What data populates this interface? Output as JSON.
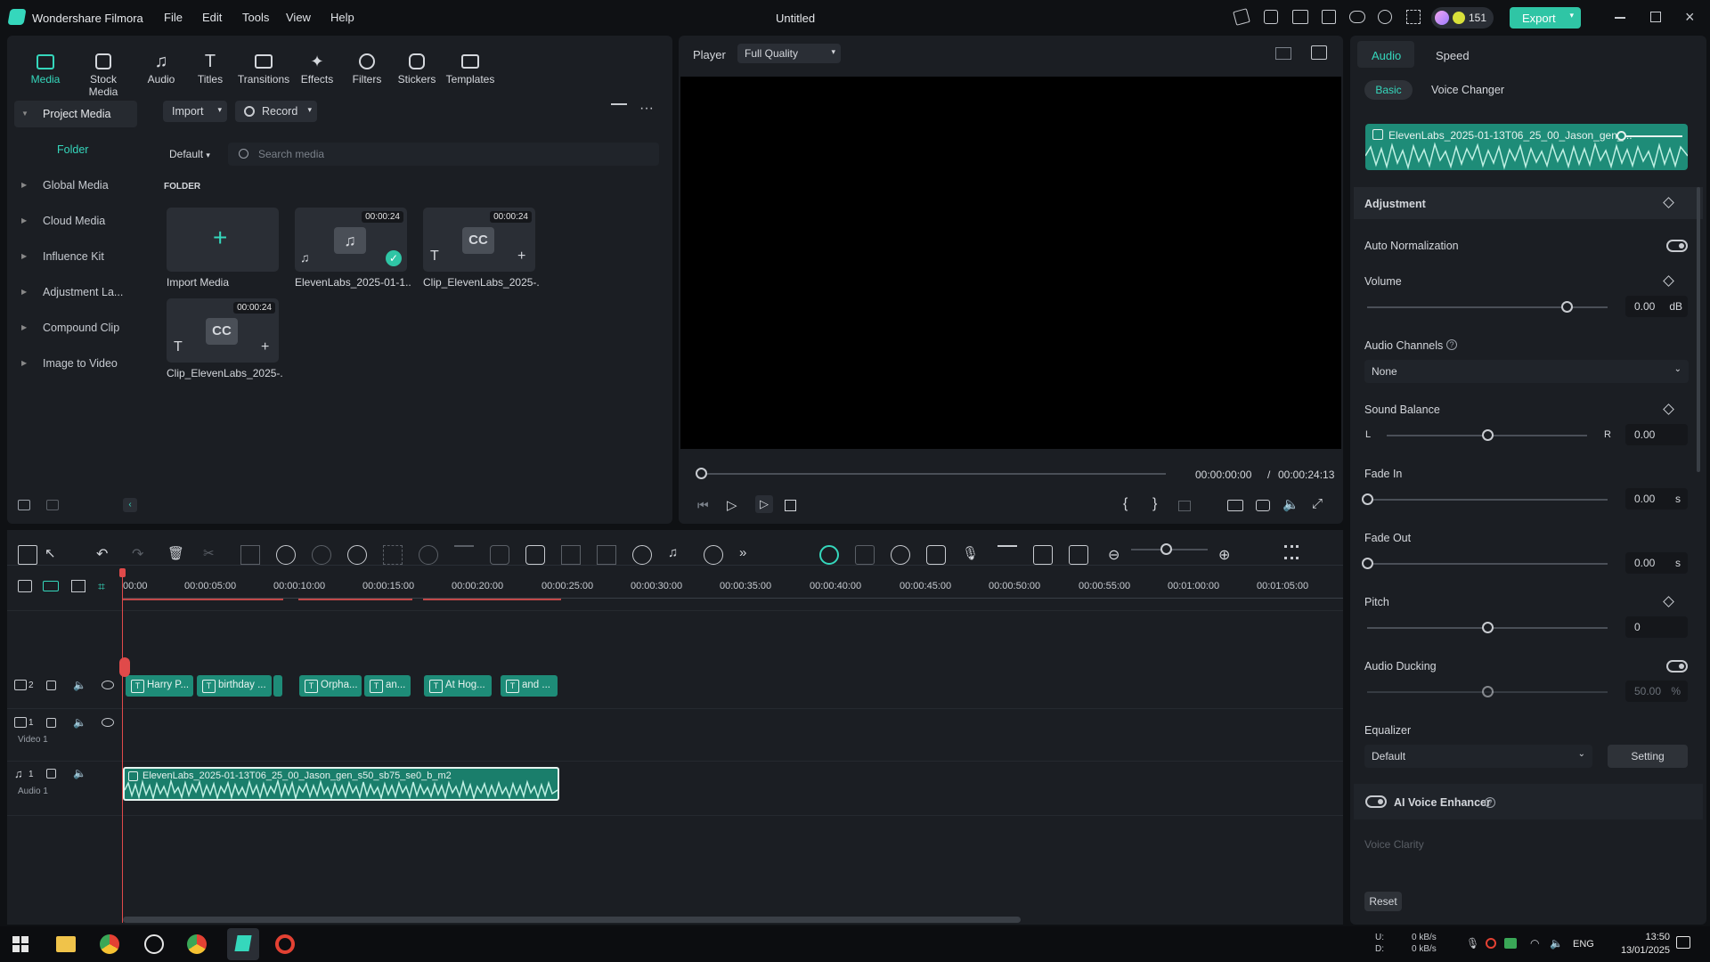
{
  "app": {
    "name": "Wondershare Filmora",
    "title": "Untitled",
    "credits": "151",
    "export_label": "Export"
  },
  "menu": [
    "File",
    "Edit",
    "Tools",
    "View",
    "Help"
  ],
  "tools": [
    {
      "label": "Media",
      "icon": "media-icon"
    },
    {
      "label": "Stock Media",
      "icon": "stock-media-icon"
    },
    {
      "label": "Audio",
      "icon": "audio-icon"
    },
    {
      "label": "Titles",
      "icon": "titles-icon"
    },
    {
      "label": "Transitions",
      "icon": "transitions-icon"
    },
    {
      "label": "Effects",
      "icon": "effects-icon"
    },
    {
      "label": "Filters",
      "icon": "filters-icon"
    },
    {
      "label": "Stickers",
      "icon": "stickers-icon"
    },
    {
      "label": "Templates",
      "icon": "templates-icon"
    }
  ],
  "sidebar": {
    "items": [
      "Project Media",
      "Folder",
      "Global Media",
      "Cloud Media",
      "Influence Kit",
      "Adjustment La...",
      "Compound Clip",
      "Image to Video"
    ]
  },
  "media": {
    "import_label": "Import",
    "record_label": "Record",
    "sort_label": "Default",
    "search_placeholder": "Search media",
    "folder_heading": "FOLDER",
    "items": [
      {
        "caption": "Import Media",
        "duration": ""
      },
      {
        "caption": "ElevenLabs_2025-01-1...",
        "duration": "00:00:24"
      },
      {
        "caption": "Clip_ElevenLabs_2025-...",
        "duration": "00:00:24"
      },
      {
        "caption": "Clip_ElevenLabs_2025-...",
        "duration": "00:00:24"
      }
    ]
  },
  "player": {
    "label": "Player",
    "quality": "Full Quality",
    "current_time": "00:00:00:00",
    "separator": "/",
    "total_time": "00:00:24:13"
  },
  "timeline": {
    "ruler": [
      "00:00",
      "00:00:05:00",
      "00:00:10:00",
      "00:00:15:00",
      "00:00:20:00",
      "00:00:25:00",
      "00:00:30:00",
      "00:00:35:00",
      "00:00:40:00",
      "00:00:45:00",
      "00:00:50:00",
      "00:00:55:00",
      "00:01:00:00",
      "00:01:05:00"
    ],
    "tracks": {
      "title_track_num": "2",
      "video_track_num": "1",
      "video_track_label": "Video 1",
      "audio_track_num": "1",
      "audio_track_label": "Audio 1"
    },
    "text_clips": [
      "Harry P...",
      "birthday ...",
      "Orpha...",
      "an...",
      "At Hog...",
      "and ..."
    ],
    "audio_clip": "ElevenLabs_2025-01-13T06_25_00_Jason_gen_s50_sb75_se0_b_m2"
  },
  "right": {
    "tabs": [
      "Audio",
      "Speed"
    ],
    "subtabs": [
      "Basic",
      "Voice Changer"
    ],
    "clip_name": "ElevenLabs_2025-01-13T06_25_00_Jason_gen_...",
    "adjustment": "Adjustment",
    "auto_norm": "Auto Normalization",
    "volume": {
      "label": "Volume",
      "value": "0.00",
      "unit": "dB",
      "level": 0.83
    },
    "channels": {
      "label": "Audio Channels",
      "value": "None"
    },
    "balance": {
      "label": "Sound Balance",
      "left": "L",
      "right": "R",
      "value": "0.00",
      "level": 0.5
    },
    "fade_in": {
      "label": "Fade In",
      "value": "0.00",
      "unit": "s",
      "level": 0.0
    },
    "fade_out": {
      "label": "Fade Out",
      "value": "0.00",
      "unit": "s",
      "level": 0.0
    },
    "pitch": {
      "label": "Pitch",
      "value": "0",
      "level": 0.5
    },
    "ducking": {
      "label": "Audio Ducking",
      "value": "50.00",
      "unit": "%",
      "level": 0.5
    },
    "equalizer": {
      "label": "Equalizer",
      "value": "Default",
      "setting": "Setting"
    },
    "enhancer": "AI Voice Enhancer",
    "clarity": "Voice Clarity",
    "reset": "Reset"
  },
  "taskbar": {
    "net_up": "0 kB/s",
    "net_down": "0 kB/s",
    "net_u": "U:",
    "net_d": "D:",
    "lang": "ENG",
    "time": "13:50",
    "date": "13/01/2025"
  },
  "colors": {
    "accent": "#35d7bc",
    "clip": "#1e8c78",
    "playhead": "#e04a4a"
  }
}
